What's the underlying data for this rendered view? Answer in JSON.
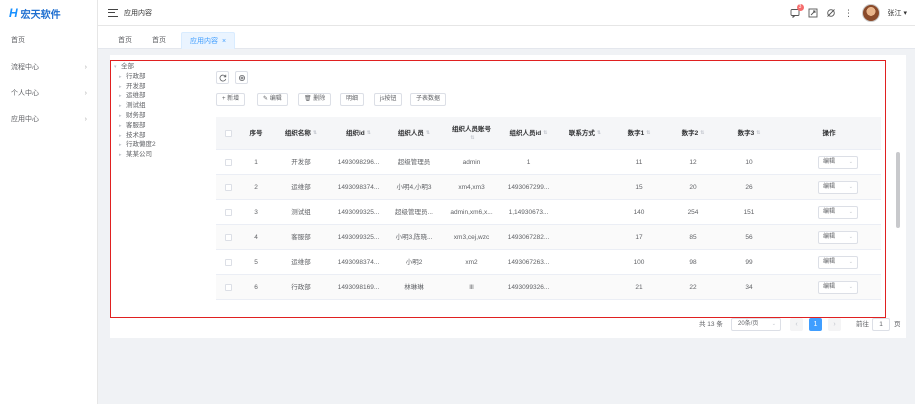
{
  "app": {
    "logo_mark": "H",
    "name": "宏天软件"
  },
  "sidebar": {
    "items": [
      {
        "label": "首页",
        "has_children": false
      },
      {
        "label": "流程中心",
        "has_children": true
      },
      {
        "label": "个人中心",
        "has_children": true
      },
      {
        "label": "应用中心",
        "has_children": true
      }
    ]
  },
  "header": {
    "breadcrumb": "应用内容",
    "notification_count": "3",
    "username": "张江"
  },
  "tabs": [
    {
      "label": "首页",
      "active": false
    },
    {
      "label": "首页",
      "active": false
    },
    {
      "label": "应用内容",
      "active": true,
      "close": "×"
    }
  ],
  "tree": {
    "root": "全部",
    "children": [
      "行政部",
      "开发部",
      "运维部",
      "测试组",
      "财务部",
      "客服部",
      "技术部",
      "行政懒度2",
      "某某公司"
    ]
  },
  "toolbar": {
    "buttons": [
      {
        "name": "add-button",
        "label": "+ 新增"
      },
      {
        "name": "edit-button",
        "label": "编辑"
      },
      {
        "name": "delete-button",
        "label": "删除"
      },
      {
        "name": "detail-button",
        "label": "明细"
      },
      {
        "name": "js-group-button",
        "label": "js按钮"
      },
      {
        "name": "sub-data-button",
        "label": "子表数据"
      }
    ]
  },
  "table": {
    "columns": [
      {
        "label": "序号",
        "sortable": false
      },
      {
        "label": "组织名称",
        "sortable": true
      },
      {
        "label": "组织id",
        "sortable": true
      },
      {
        "label": "组织人员",
        "sortable": true
      },
      {
        "label": "组织人员账号",
        "sortable": true
      },
      {
        "label": "组织人员id",
        "sortable": true
      },
      {
        "label": "联系方式",
        "sortable": true
      },
      {
        "label": "数字1",
        "sortable": true
      },
      {
        "label": "数字2",
        "sortable": true
      },
      {
        "label": "数字3",
        "sortable": true
      },
      {
        "label": "操作",
        "sortable": false
      }
    ],
    "rows": [
      [
        "1",
        "开发部",
        "1493098296...",
        "超级管理员",
        "admin",
        "1",
        "",
        "11",
        "12",
        "10",
        "编辑"
      ],
      [
        "2",
        "运维部",
        "1493098374...",
        "小明4,小明3",
        "xm4,xm3",
        "1493067299...",
        "",
        "15",
        "20",
        "26",
        "编辑"
      ],
      [
        "3",
        "测试组",
        "1493099325...",
        "超级管理员...",
        "admin,xm6,x...",
        "1,14930673...",
        "",
        "140",
        "254",
        "151",
        "编辑"
      ],
      [
        "4",
        "客服部",
        "1493099325...",
        "小明3,陈晓...",
        "xm3,cej,wzc",
        "1493067282...",
        "",
        "17",
        "85",
        "56",
        "编辑"
      ],
      [
        "5",
        "运维部",
        "1493098374...",
        "小明2",
        "xm2",
        "1493067263...",
        "",
        "100",
        "98",
        "99",
        "编辑"
      ],
      [
        "6",
        "行政部",
        "1493098169...",
        "林琳琳",
        "lll",
        "1493099326...",
        "",
        "21",
        "22",
        "34",
        "编辑"
      ]
    ],
    "op_arrow": "⌄"
  },
  "pagination": {
    "total": "共 13 条",
    "page_size": "20条/页",
    "current": "1",
    "prev": "‹",
    "next": "›",
    "goto": "前往",
    "goto_value": "1",
    "unit": "页"
  }
}
